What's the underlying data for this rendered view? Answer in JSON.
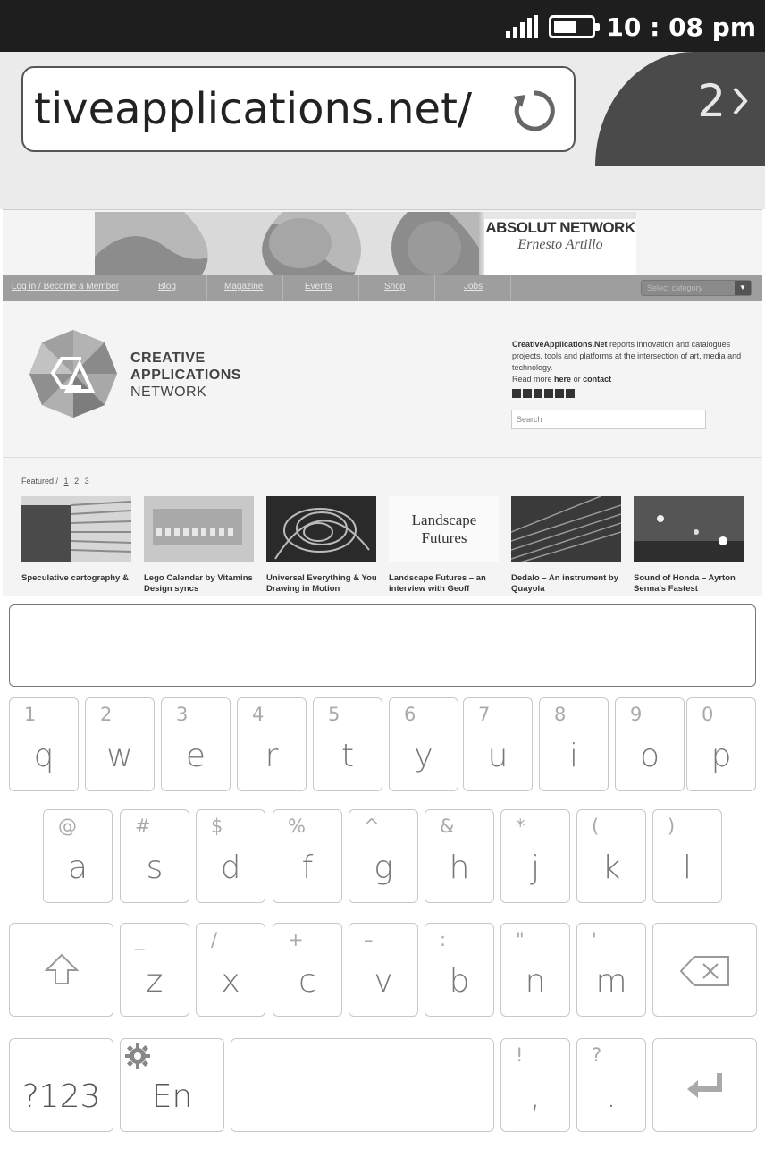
{
  "status_bar": {
    "time": "10 : 08 pm",
    "battery_level": 0.62
  },
  "browser": {
    "url": "tiveapplications.net/",
    "tab_count": "2"
  },
  "site": {
    "banner": {
      "brand_line1": "ABSOLUT NETWORK",
      "brand_line2": "Ernesto Artillo"
    },
    "nav": {
      "items": [
        "Log in / Become a Member",
        "Blog",
        "Magazine",
        "Events",
        "Shop",
        "Jobs"
      ],
      "select_placeholder": "Select category"
    },
    "logo": {
      "line1": "CREATIVE",
      "line2": "APPLICATIONS",
      "line3": "NETWORK"
    },
    "about": {
      "name": "CreativeApplications.Net",
      "text": "reports innovation and catalogues projects, tools and platforms at the intersection of art, media and technology.",
      "read_more_prefix": "Read more",
      "here": "here",
      "or": "or",
      "contact": "contact"
    },
    "search_placeholder": "Search",
    "featured": {
      "label": "Featured /",
      "pages": [
        "1",
        "2",
        "3"
      ]
    },
    "articles": [
      {
        "title": "Speculative cartography &"
      },
      {
        "title": "Lego Calendar by Vitamins Design syncs"
      },
      {
        "title": "Universal Everything & You Drawing in Motion"
      },
      {
        "title": "Landscape Futures – an interview with Geoff",
        "thumb_text1": "Landscape",
        "thumb_text2": "Futures"
      },
      {
        "title": "Dedalo – An instrument by Quayola"
      },
      {
        "title": "Sound of Honda – Ayrton Senna's Fastest"
      }
    ]
  },
  "keyboard": {
    "row1": [
      {
        "key": "q",
        "num": "1"
      },
      {
        "key": "w",
        "num": "2"
      },
      {
        "key": "e",
        "num": "3"
      },
      {
        "key": "r",
        "num": "4"
      },
      {
        "key": "t",
        "num": "5"
      },
      {
        "key": "y",
        "num": "6"
      },
      {
        "key": "u",
        "num": "7"
      },
      {
        "key": "i",
        "num": "8"
      },
      {
        "key": "o",
        "num": "9"
      },
      {
        "key": "p",
        "num": "0"
      }
    ],
    "row2": [
      {
        "key": "a",
        "sym": "@"
      },
      {
        "key": "s",
        "sym": "#"
      },
      {
        "key": "d",
        "sym": "$"
      },
      {
        "key": "f",
        "sym": "%"
      },
      {
        "key": "g",
        "sym": "^"
      },
      {
        "key": "h",
        "sym": "&"
      },
      {
        "key": "j",
        "sym": "*"
      },
      {
        "key": "k",
        "sym": "("
      },
      {
        "key": "l",
        "sym": ")"
      }
    ],
    "row3": [
      {
        "key": "z",
        "sym": "_"
      },
      {
        "key": "x",
        "sym": "/"
      },
      {
        "key": "c",
        "sym": "+"
      },
      {
        "key": "v",
        "sym": "–"
      },
      {
        "key": "b",
        "sym": ":"
      },
      {
        "key": "n",
        "sym": "\""
      },
      {
        "key": "m",
        "sym": "'"
      }
    ],
    "symbols_key": "?123",
    "lang_key": "En",
    "comma_key": ",",
    "comma_sym": "!",
    "period_key": ".",
    "period_sym": "?"
  }
}
